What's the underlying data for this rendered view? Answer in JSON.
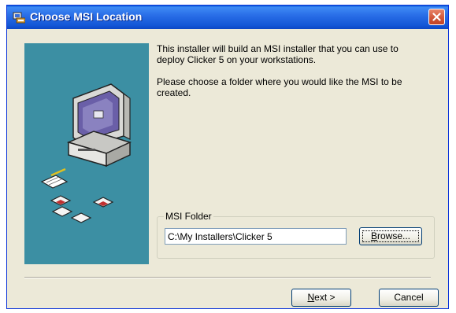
{
  "window": {
    "title": "Choose MSI Location",
    "titlebar_color": "#2a6fe8",
    "close_icon": "close-icon"
  },
  "body": {
    "line1": "This installer will build an MSI installer that you can use to deploy Clicker 5 on your workstations.",
    "line2": "Please choose a folder where you would like the MSI to be created."
  },
  "banner": {
    "color": "#3c8fa3",
    "icon": "computer-with-disks-icon"
  },
  "folder_group": {
    "label": "MSI Folder",
    "value": "C:\\My Installers\\Clicker 5",
    "browse_label_prefix": "",
    "browse_label_mnemonic": "B",
    "browse_label_rest": "rowse..."
  },
  "buttons": {
    "next_mnemonic": "N",
    "next_rest": "ext >",
    "cancel": "Cancel"
  }
}
